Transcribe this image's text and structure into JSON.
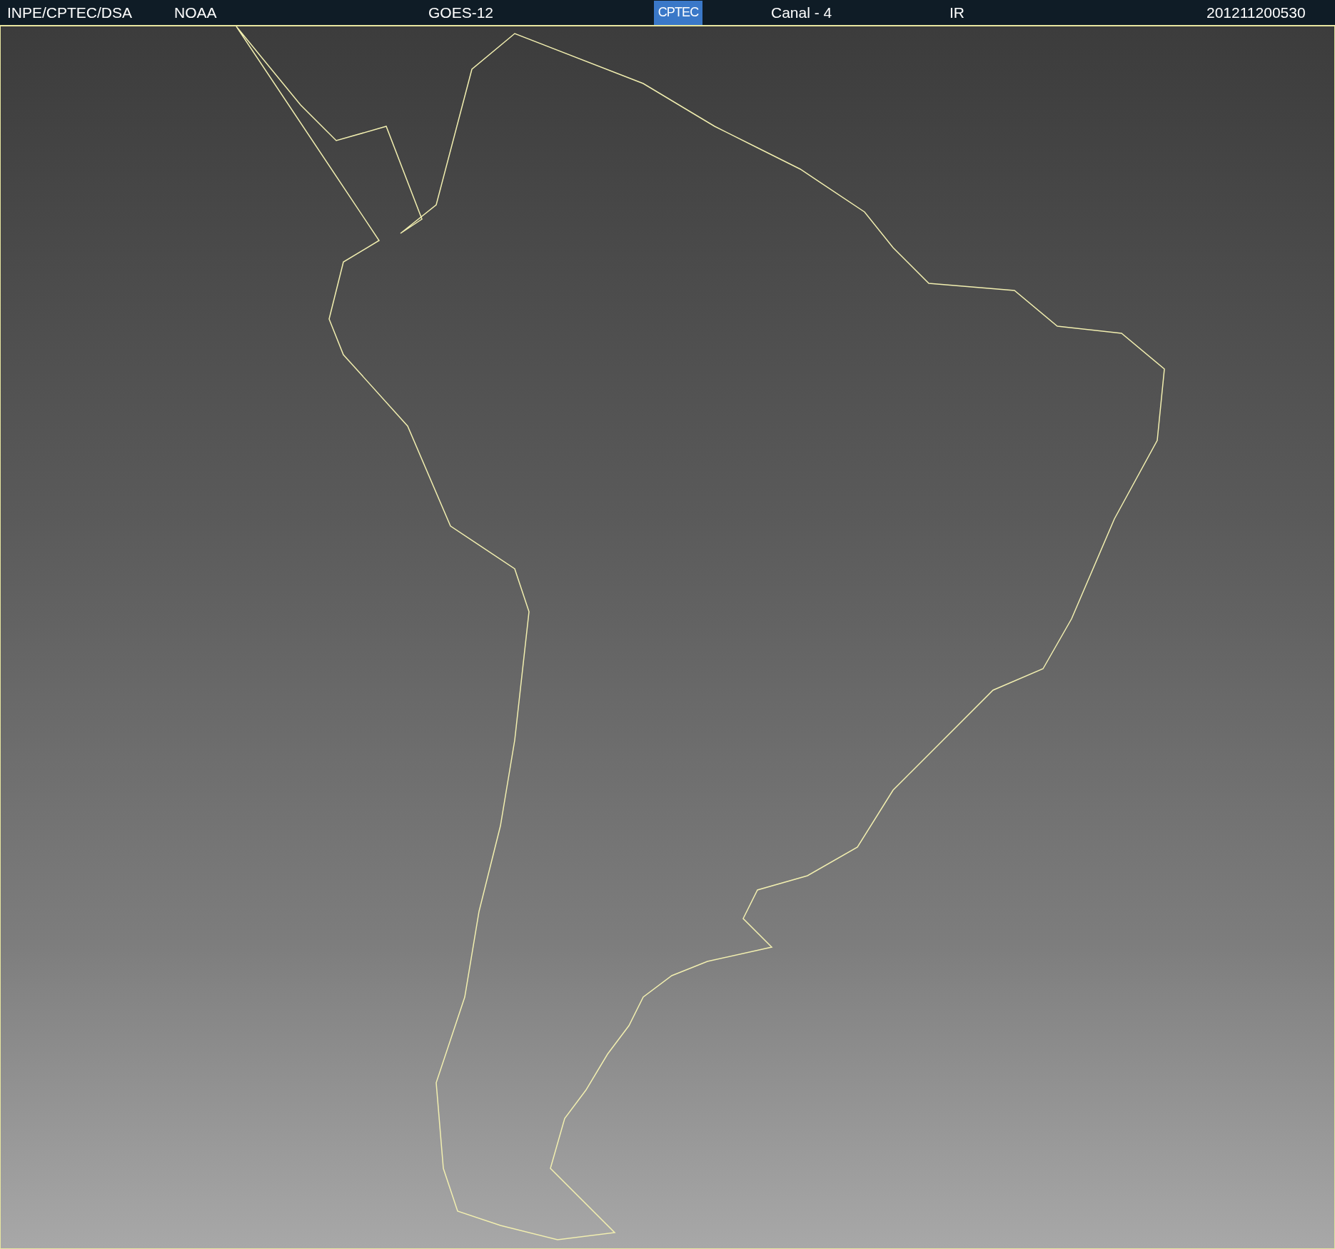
{
  "header": {
    "source": "INPE/CPTEC/DSA",
    "agency": "NOAA",
    "satellite": "GOES-12",
    "logo": "CPTEC",
    "channel": "Canal - 4",
    "band": "IR",
    "timestamp": "201211200530"
  }
}
